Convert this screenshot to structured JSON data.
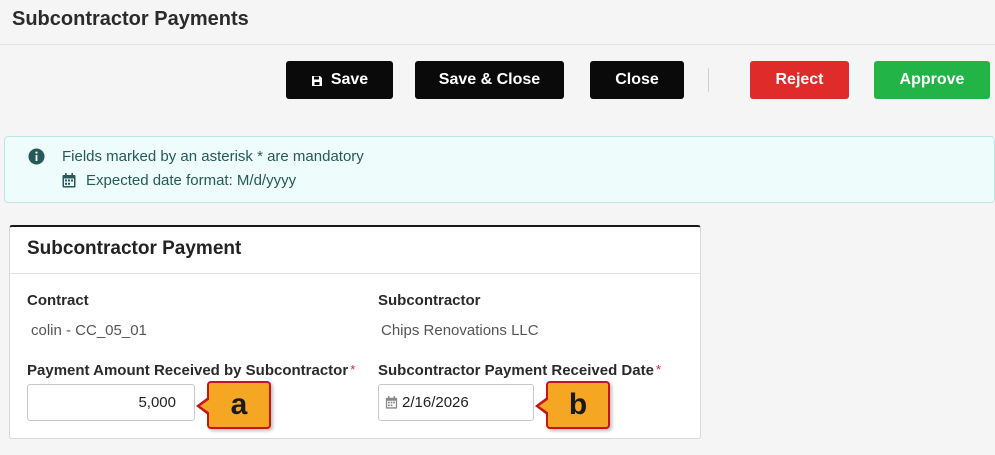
{
  "header": {
    "title": "Subcontractor Payments"
  },
  "toolbar": {
    "save_label": "Save",
    "save_close_label": "Save & Close",
    "close_label": "Close",
    "reject_label": "Reject",
    "approve_label": "Approve"
  },
  "alert": {
    "mandatory_text": "Fields marked by an asterisk * are mandatory",
    "date_format_text": "Expected date format: M/d/yyyy"
  },
  "card": {
    "title": "Subcontractor Payment",
    "contract_label": "Contract",
    "contract_value": "colin - CC_05_01",
    "subcontractor_label": "Subcontractor",
    "subcontractor_value": "Chips Renovations LLC",
    "amount_label": "Payment Amount Received by Subcontractor",
    "amount_value": "5,000",
    "date_label": "Subcontractor Payment Received Date",
    "date_value": "2/16/2026",
    "required_marker": "*"
  },
  "callouts": {
    "a": "a",
    "b": "b"
  },
  "colors": {
    "reject": "#e02b2b",
    "approve": "#23b448",
    "callout_fill": "#f5a623",
    "callout_border": "#c4151c",
    "alert_bg": "#eefcfb"
  },
  "icons": {
    "save": "floppy-disk-icon",
    "info": "info-circle-icon",
    "calendar": "calendar-icon"
  }
}
